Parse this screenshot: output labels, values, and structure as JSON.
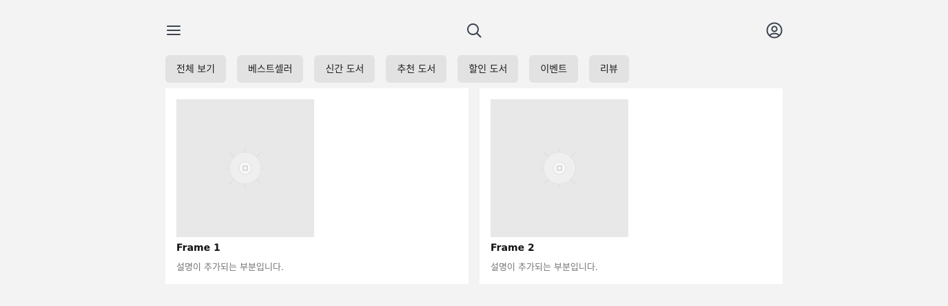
{
  "header": {
    "menu_icon": "menu-icon",
    "search_icon": "search-icon",
    "user_icon": "user-icon"
  },
  "tabs": [
    {
      "label": "전체 보기"
    },
    {
      "label": "베스트셀러"
    },
    {
      "label": "신간 도서"
    },
    {
      "label": "추천 도서"
    },
    {
      "label": "할인 도서"
    },
    {
      "label": "이벤트"
    },
    {
      "label": "리뷰"
    }
  ],
  "cards": [
    {
      "title": "Frame 1",
      "description": "설명이 추가되는 부분입니다.",
      "image_icon": "image-placeholder-icon"
    },
    {
      "title": "Frame 2",
      "description": "설명이 추가되는 부분입니다.",
      "image_icon": "image-placeholder-icon"
    }
  ],
  "colors": {
    "background": "#f3f3f3",
    "tab_background": "#e2e2e2",
    "card_background": "#ffffff",
    "thumbnail_background": "#e8e8e8",
    "icon_stroke": "#3c4450",
    "description_text": "#777777"
  }
}
